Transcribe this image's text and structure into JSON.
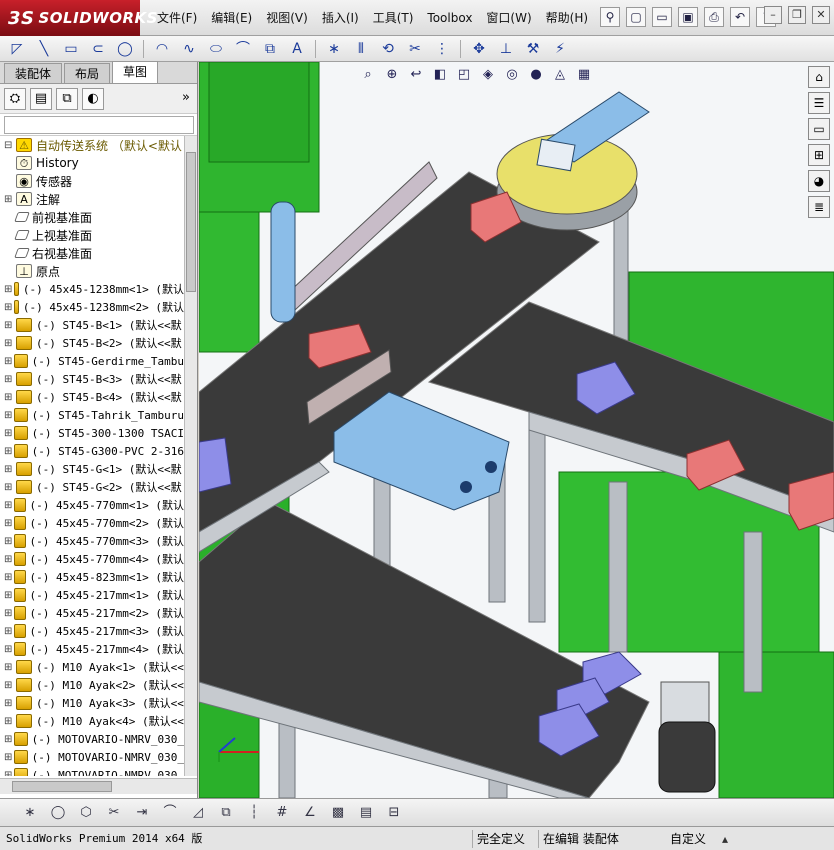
{
  "app": {
    "logo": "SOLIDWORKS",
    "logo_mark": "3S"
  },
  "menus": [
    "文件(F)",
    "编辑(E)",
    "视图(V)",
    "插入(I)",
    "工具(T)",
    "Toolbox",
    "窗口(W)",
    "帮助(H)"
  ],
  "quick_access_icons": [
    "pushpin-icon",
    "new-document-icon",
    "open-folder-icon",
    "save-icon",
    "print-icon",
    "undo-icon",
    "help-icon"
  ],
  "window_controls": [
    "minimize-icon",
    "restore-icon",
    "close-icon"
  ],
  "sketch_tools": [
    "smart-dimension-icon",
    "line-icon",
    "rectangle-icon",
    "slot-icon",
    "circle-icon",
    "arc-icon",
    "spline-icon",
    "ellipse-icon",
    "fillet-icon",
    "offset-icon",
    "text-icon",
    "point-icon",
    "mirror-icon",
    "convert-icon",
    "trim-icon",
    "pattern-icon",
    "move-icon",
    "relations-icon",
    "repair-icon",
    "rapid-sketch-icon"
  ],
  "left_tabs": [
    "装配体",
    "布局",
    "草图"
  ],
  "active_tab": "草图",
  "filter_placeholder": "",
  "tree": {
    "root": "自动传送系统  （默认<默认",
    "fixed_items": [
      {
        "label": "History",
        "icon": "history-icon"
      },
      {
        "label": "传感器",
        "icon": "sensor-icon"
      },
      {
        "label": "注解",
        "icon": "annotation-icon"
      },
      {
        "label": "前视基准面",
        "icon": "plane-icon"
      },
      {
        "label": "上视基准面",
        "icon": "plane-icon"
      },
      {
        "label": "右视基准面",
        "icon": "plane-icon"
      },
      {
        "label": "原点",
        "icon": "origin-icon"
      }
    ],
    "components": [
      "(-) 45x45-1238mm<1> (默认",
      "(-) 45x45-1238mm<2> (默认",
      "(-) ST45-B<1> (默认<<默",
      "(-) ST45-B<2> (默认<<默",
      "(-) ST45-Gerdirme_Tambu",
      "(-) ST45-B<3> (默认<<默",
      "(-) ST45-B<4> (默认<<默",
      "(-) ST45-Tahrik_Tamburu",
      "(-) ST45-300-1300 TSACI",
      "(-) ST45-G300-PVC 2-316",
      "(-) ST45-G<1> (默认<<默",
      "(-) ST45-G<2> (默认<<默",
      "(-) 45x45-770mm<1> (默认",
      "(-) 45x45-770mm<2> (默认",
      "(-) 45x45-770mm<3> (默认",
      "(-) 45x45-770mm<4> (默认",
      "(-) 45x45-823mm<1> (默认",
      "(-) 45x45-217mm<1> (默认",
      "(-) 45x45-217mm<2> (默认",
      "(-) 45x45-217mm<3> (默认",
      "(-) 45x45-217mm<4> (默认",
      "(-) M10 Ayak<1> (默认<<",
      "(-) M10 Ayak<2> (默认<<",
      "(-) M10 Ayak<3> (默认<<",
      "(-) M10 Ayak<4> (默认<<",
      "(-) MOTOVARIO-NMRV_030_",
      "(-) MOTOVARIO-NMRV_030_",
      "(-) MOTOVARIO-NMRV_030_"
    ]
  },
  "view_tools": [
    "zoom-to-fit-icon",
    "zoom-area-icon",
    "previous-view-icon",
    "section-view-icon",
    "view-orientation-icon",
    "display-style-icon",
    "hide-show-icon",
    "appearance-icon",
    "scene-icon",
    "view-settings-icon"
  ],
  "task_pane": [
    "home-icon",
    "resources-icon",
    "file-explorer-icon",
    "view-palette-icon",
    "appearances-icon",
    "custom-properties-icon"
  ],
  "bottom_tools": [
    "point-icon",
    "circle-icon",
    "polygon-icon",
    "trim-icon",
    "extend-icon",
    "fillet-icon",
    "chamfer-icon",
    "offset-icon",
    "construction-icon",
    "grid-icon",
    "relation-icon",
    "shaded-sketch-icon",
    "sketch-plane-icon",
    "table-icon"
  ],
  "status": {
    "app": "SolidWorks Premium 2014 x64 版",
    "defined": "完全定义",
    "editing": "在编辑 装配体",
    "custom": "自定义",
    "caret": "▴"
  },
  "colors": {
    "conveyor_belt": "#3a3a3a",
    "frame": "#b9bec4",
    "bin_green": "#2fb52f",
    "red_box": "#e87878",
    "blue_box": "#8e8ee8",
    "motor_blue": "#8bbde8",
    "turntable_yellow": "#e8e06a",
    "logo_red": "#c8202a"
  }
}
